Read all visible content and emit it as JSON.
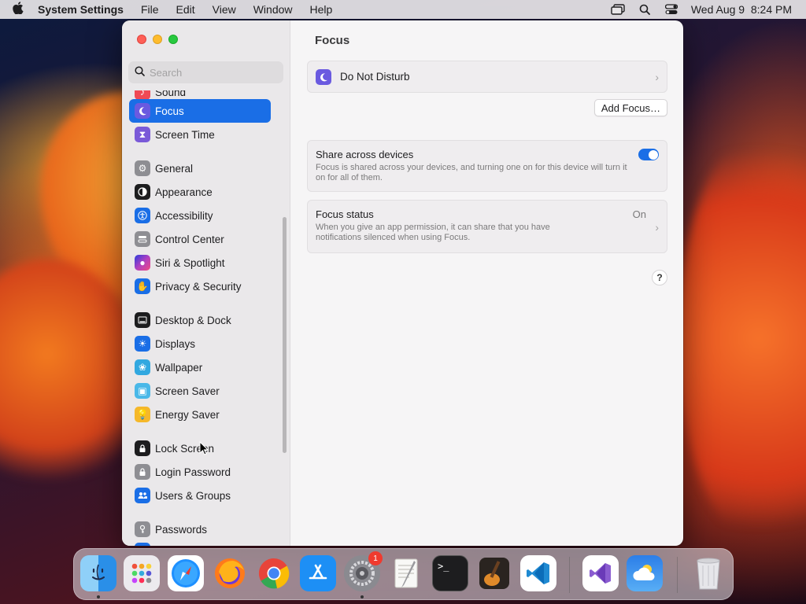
{
  "menubar": {
    "app_name": "System Settings",
    "menus": [
      "File",
      "Edit",
      "View",
      "Window",
      "Help"
    ],
    "clock": "Wed Aug 9  8:24 PM"
  },
  "window": {
    "search_placeholder": "Search",
    "sidebar": {
      "partial_top": "Sound",
      "items": [
        {
          "label": "Focus",
          "icon": "moon-icon",
          "color": "#6a5ae0",
          "selected": true
        },
        {
          "label": "Screen Time",
          "icon": "hourglass-icon",
          "color": "#7a5ad8"
        },
        {
          "label": "General",
          "icon": "gear-icon",
          "color": "#8e8e93"
        },
        {
          "label": "Appearance",
          "icon": "appearance-icon",
          "color": "#1d1d1f"
        },
        {
          "label": "Accessibility",
          "icon": "accessibility-icon",
          "color": "#1a6ee6"
        },
        {
          "label": "Control Center",
          "icon": "control-center-icon",
          "color": "#8e8e93"
        },
        {
          "label": "Siri & Spotlight",
          "icon": "siri-icon",
          "color": "#b040c0"
        },
        {
          "label": "Privacy & Security",
          "icon": "hand-icon",
          "color": "#1a6ee6"
        },
        {
          "label": "Desktop & Dock",
          "icon": "dock-icon",
          "color": "#1d1d1f"
        },
        {
          "label": "Displays",
          "icon": "sun-icon",
          "color": "#1a6ee6"
        },
        {
          "label": "Wallpaper",
          "icon": "flower-icon",
          "color": "#32a8e0"
        },
        {
          "label": "Screen Saver",
          "icon": "screen-saver-icon",
          "color": "#4ab8e8"
        },
        {
          "label": "Energy Saver",
          "icon": "bulb-icon",
          "color": "#f5b82a"
        },
        {
          "label": "Lock Screen",
          "icon": "lock-icon",
          "color": "#1d1d1f"
        },
        {
          "label": "Login Password",
          "icon": "padlock-icon",
          "color": "#8e8e93"
        },
        {
          "label": "Users & Groups",
          "icon": "users-icon",
          "color": "#1a6ee6"
        },
        {
          "label": "Passwords",
          "icon": "key-icon",
          "color": "#8e8e93"
        }
      ]
    },
    "content": {
      "title": "Focus",
      "dnd_label": "Do Not Disturb",
      "add_focus": "Add Focus…",
      "share": {
        "title": "Share across devices",
        "description": "Focus is shared across your devices, and turning one on for this device will turn it on for all of them.",
        "enabled": true
      },
      "status": {
        "title": "Focus status",
        "value": "On",
        "description": "When you give an app permission, it can share that you have notifications silenced when using Focus."
      },
      "help": "?"
    }
  },
  "dock": {
    "badge_count": "1",
    "apps": [
      "Finder",
      "Launchpad",
      "Safari",
      "Firefox",
      "Chrome",
      "App Store",
      "System Settings",
      "TextEdit",
      "Terminal",
      "GarageBand",
      "VS Code",
      "Visual Studio",
      "Weather",
      "Trash"
    ]
  }
}
